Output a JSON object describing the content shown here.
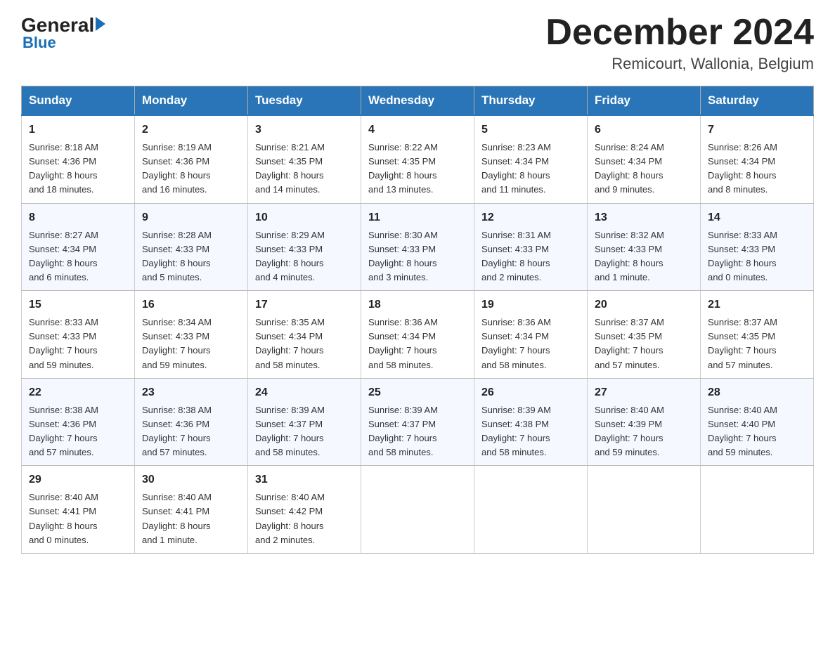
{
  "header": {
    "logo_general": "General",
    "logo_blue": "Blue",
    "month_title": "December 2024",
    "location": "Remicourt, Wallonia, Belgium"
  },
  "days_of_week": [
    "Sunday",
    "Monday",
    "Tuesday",
    "Wednesday",
    "Thursday",
    "Friday",
    "Saturday"
  ],
  "weeks": [
    [
      {
        "day": "1",
        "sunrise": "8:18 AM",
        "sunset": "4:36 PM",
        "daylight_hours": "8",
        "daylight_minutes": "18"
      },
      {
        "day": "2",
        "sunrise": "8:19 AM",
        "sunset": "4:36 PM",
        "daylight_hours": "8",
        "daylight_minutes": "16"
      },
      {
        "day": "3",
        "sunrise": "8:21 AM",
        "sunset": "4:35 PM",
        "daylight_hours": "8",
        "daylight_minutes": "14"
      },
      {
        "day": "4",
        "sunrise": "8:22 AM",
        "sunset": "4:35 PM",
        "daylight_hours": "8",
        "daylight_minutes": "13"
      },
      {
        "day": "5",
        "sunrise": "8:23 AM",
        "sunset": "4:34 PM",
        "daylight_hours": "8",
        "daylight_minutes": "11"
      },
      {
        "day": "6",
        "sunrise": "8:24 AM",
        "sunset": "4:34 PM",
        "daylight_hours": "8",
        "daylight_minutes": "9"
      },
      {
        "day": "7",
        "sunrise": "8:26 AM",
        "sunset": "4:34 PM",
        "daylight_hours": "8",
        "daylight_minutes": "8"
      }
    ],
    [
      {
        "day": "8",
        "sunrise": "8:27 AM",
        "sunset": "4:34 PM",
        "daylight_hours": "8",
        "daylight_minutes": "6"
      },
      {
        "day": "9",
        "sunrise": "8:28 AM",
        "sunset": "4:33 PM",
        "daylight_hours": "8",
        "daylight_minutes": "5"
      },
      {
        "day": "10",
        "sunrise": "8:29 AM",
        "sunset": "4:33 PM",
        "daylight_hours": "8",
        "daylight_minutes": "4"
      },
      {
        "day": "11",
        "sunrise": "8:30 AM",
        "sunset": "4:33 PM",
        "daylight_hours": "8",
        "daylight_minutes": "3"
      },
      {
        "day": "12",
        "sunrise": "8:31 AM",
        "sunset": "4:33 PM",
        "daylight_hours": "8",
        "daylight_minutes": "2"
      },
      {
        "day": "13",
        "sunrise": "8:32 AM",
        "sunset": "4:33 PM",
        "daylight_hours": "8",
        "daylight_minutes": "1",
        "daylight_unit": "minute"
      },
      {
        "day": "14",
        "sunrise": "8:33 AM",
        "sunset": "4:33 PM",
        "daylight_hours": "8",
        "daylight_minutes": "0"
      }
    ],
    [
      {
        "day": "15",
        "sunrise": "8:33 AM",
        "sunset": "4:33 PM",
        "daylight_hours": "7",
        "daylight_minutes": "59"
      },
      {
        "day": "16",
        "sunrise": "8:34 AM",
        "sunset": "4:33 PM",
        "daylight_hours": "7",
        "daylight_minutes": "59"
      },
      {
        "day": "17",
        "sunrise": "8:35 AM",
        "sunset": "4:34 PM",
        "daylight_hours": "7",
        "daylight_minutes": "58"
      },
      {
        "day": "18",
        "sunrise": "8:36 AM",
        "sunset": "4:34 PM",
        "daylight_hours": "7",
        "daylight_minutes": "58"
      },
      {
        "day": "19",
        "sunrise": "8:36 AM",
        "sunset": "4:34 PM",
        "daylight_hours": "7",
        "daylight_minutes": "58"
      },
      {
        "day": "20",
        "sunrise": "8:37 AM",
        "sunset": "4:35 PM",
        "daylight_hours": "7",
        "daylight_minutes": "57"
      },
      {
        "day": "21",
        "sunrise": "8:37 AM",
        "sunset": "4:35 PM",
        "daylight_hours": "7",
        "daylight_minutes": "57"
      }
    ],
    [
      {
        "day": "22",
        "sunrise": "8:38 AM",
        "sunset": "4:36 PM",
        "daylight_hours": "7",
        "daylight_minutes": "57"
      },
      {
        "day": "23",
        "sunrise": "8:38 AM",
        "sunset": "4:36 PM",
        "daylight_hours": "7",
        "daylight_minutes": "57"
      },
      {
        "day": "24",
        "sunrise": "8:39 AM",
        "sunset": "4:37 PM",
        "daylight_hours": "7",
        "daylight_minutes": "58"
      },
      {
        "day": "25",
        "sunrise": "8:39 AM",
        "sunset": "4:37 PM",
        "daylight_hours": "7",
        "daylight_minutes": "58"
      },
      {
        "day": "26",
        "sunrise": "8:39 AM",
        "sunset": "4:38 PM",
        "daylight_hours": "7",
        "daylight_minutes": "58"
      },
      {
        "day": "27",
        "sunrise": "8:40 AM",
        "sunset": "4:39 PM",
        "daylight_hours": "7",
        "daylight_minutes": "59"
      },
      {
        "day": "28",
        "sunrise": "8:40 AM",
        "sunset": "4:40 PM",
        "daylight_hours": "7",
        "daylight_minutes": "59"
      }
    ],
    [
      {
        "day": "29",
        "sunrise": "8:40 AM",
        "sunset": "4:41 PM",
        "daylight_hours": "8",
        "daylight_minutes": "0"
      },
      {
        "day": "30",
        "sunrise": "8:40 AM",
        "sunset": "4:41 PM",
        "daylight_hours": "8",
        "daylight_minutes": "1",
        "daylight_unit": "minute"
      },
      {
        "day": "31",
        "sunrise": "8:40 AM",
        "sunset": "4:42 PM",
        "daylight_hours": "8",
        "daylight_minutes": "2"
      },
      null,
      null,
      null,
      null
    ]
  ],
  "labels": {
    "sunrise": "Sunrise:",
    "sunset": "Sunset:",
    "daylight": "Daylight:",
    "and": "and",
    "minutes": "minutes.",
    "minute": "minute.",
    "hours": "hours",
    "zero_minutes": "and 0 minutes."
  }
}
